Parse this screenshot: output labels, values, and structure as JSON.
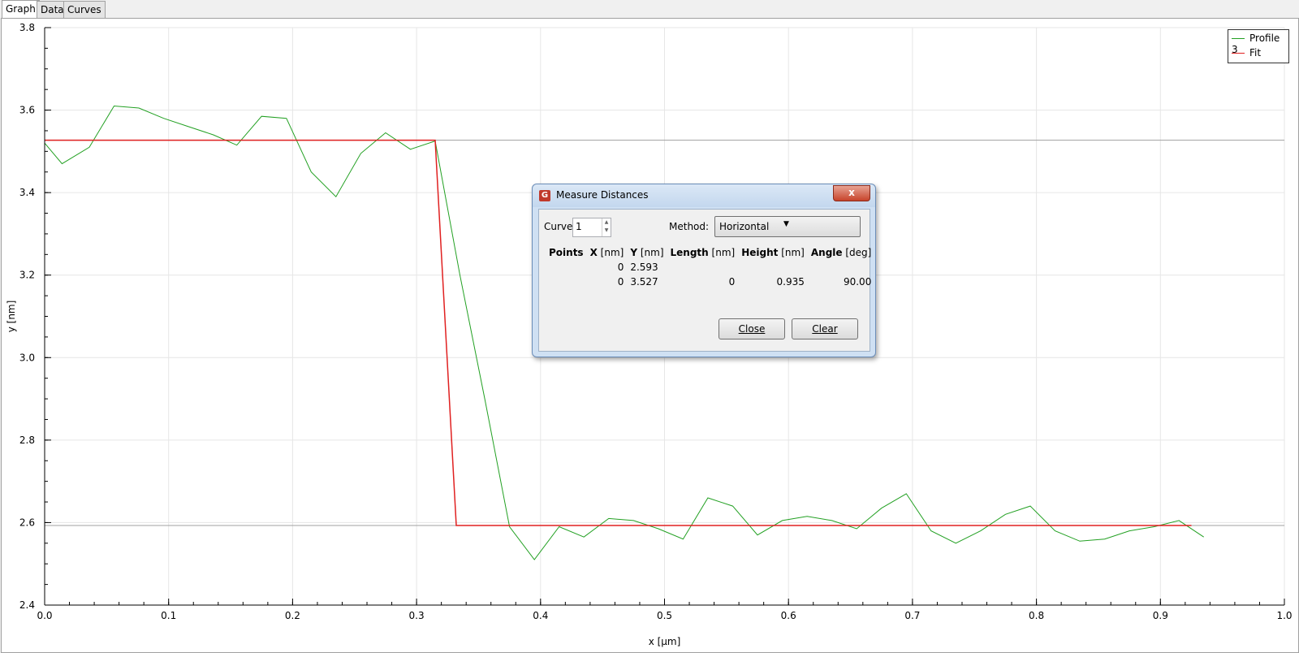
{
  "tabs": [
    "Graph",
    "Data",
    "Curves"
  ],
  "chart_data": {
    "type": "line",
    "xlabel": "x [µm]",
    "ylabel": "y [nm]",
    "xlim": [
      0.0,
      1.0
    ],
    "ylim": [
      2.4,
      3.8
    ],
    "x_ticks": [
      "0.0",
      "0.1",
      "0.2",
      "0.3",
      "0.4",
      "0.5",
      "0.6",
      "0.7",
      "0.8",
      "0.9",
      "1.0"
    ],
    "y_ticks": [
      "2.4",
      "2.6",
      "2.8",
      "3.0",
      "3.2",
      "3.4",
      "3.6",
      "3.8"
    ],
    "grid": true,
    "legend_position": "top-right",
    "hlines": [
      3.527,
      2.593
    ],
    "series": [
      {
        "name": "Profile 3",
        "color": "#22a022",
        "x": [
          0.0,
          0.014,
          0.036,
          0.056,
          0.076,
          0.096,
          0.116,
          0.136,
          0.155,
          0.175,
          0.195,
          0.215,
          0.235,
          0.255,
          0.275,
          0.295,
          0.315,
          0.335,
          0.355,
          0.375,
          0.395,
          0.415,
          0.435,
          0.455,
          0.475,
          0.495,
          0.515,
          0.535,
          0.555,
          0.575,
          0.595,
          0.615,
          0.635,
          0.655,
          0.675,
          0.695,
          0.715,
          0.735,
          0.755,
          0.775,
          0.795,
          0.815,
          0.835,
          0.855,
          0.875,
          0.895,
          0.915,
          0.935
        ],
        "y": [
          3.52,
          3.47,
          3.51,
          3.61,
          3.605,
          3.58,
          3.56,
          3.54,
          3.515,
          3.585,
          3.58,
          3.45,
          3.39,
          3.495,
          3.545,
          3.505,
          3.525,
          3.2,
          2.9,
          2.59,
          2.51,
          2.59,
          2.565,
          2.61,
          2.605,
          2.585,
          2.56,
          2.66,
          2.64,
          2.57,
          2.605,
          2.615,
          2.605,
          2.585,
          2.635,
          2.67,
          2.58,
          2.55,
          2.58,
          2.62,
          2.64,
          2.58,
          2.555,
          2.56,
          2.58,
          2.59,
          2.605,
          2.565
        ]
      },
      {
        "name": "Fit",
        "color": "#e02020",
        "x": [
          0.0,
          0.315,
          0.332,
          0.925
        ],
        "y": [
          3.527,
          3.527,
          2.593,
          2.593
        ]
      }
    ]
  },
  "dialog": {
    "title": "Measure Distances",
    "close_x": "x",
    "curve_label": "Curve:",
    "curve_value": "1",
    "method_label": "Method:",
    "method_value": "Horizontal",
    "columns": [
      {
        "bold": "Points",
        "unit": ""
      },
      {
        "bold": "X",
        "unit": " [nm]"
      },
      {
        "bold": "Y",
        "unit": " [nm]"
      },
      {
        "bold": "Length",
        "unit": " [nm]"
      },
      {
        "bold": "Height",
        "unit": " [nm]"
      },
      {
        "bold": "Angle",
        "unit": " [deg]"
      }
    ],
    "rows": [
      {
        "x": "0",
        "y": "2.593",
        "length": "",
        "height": "",
        "angle": ""
      },
      {
        "x": "0",
        "y": "3.527",
        "length": "0",
        "height": "0.935",
        "angle": "90.00"
      }
    ],
    "close_button": "Close",
    "clear_button": "Clear"
  }
}
